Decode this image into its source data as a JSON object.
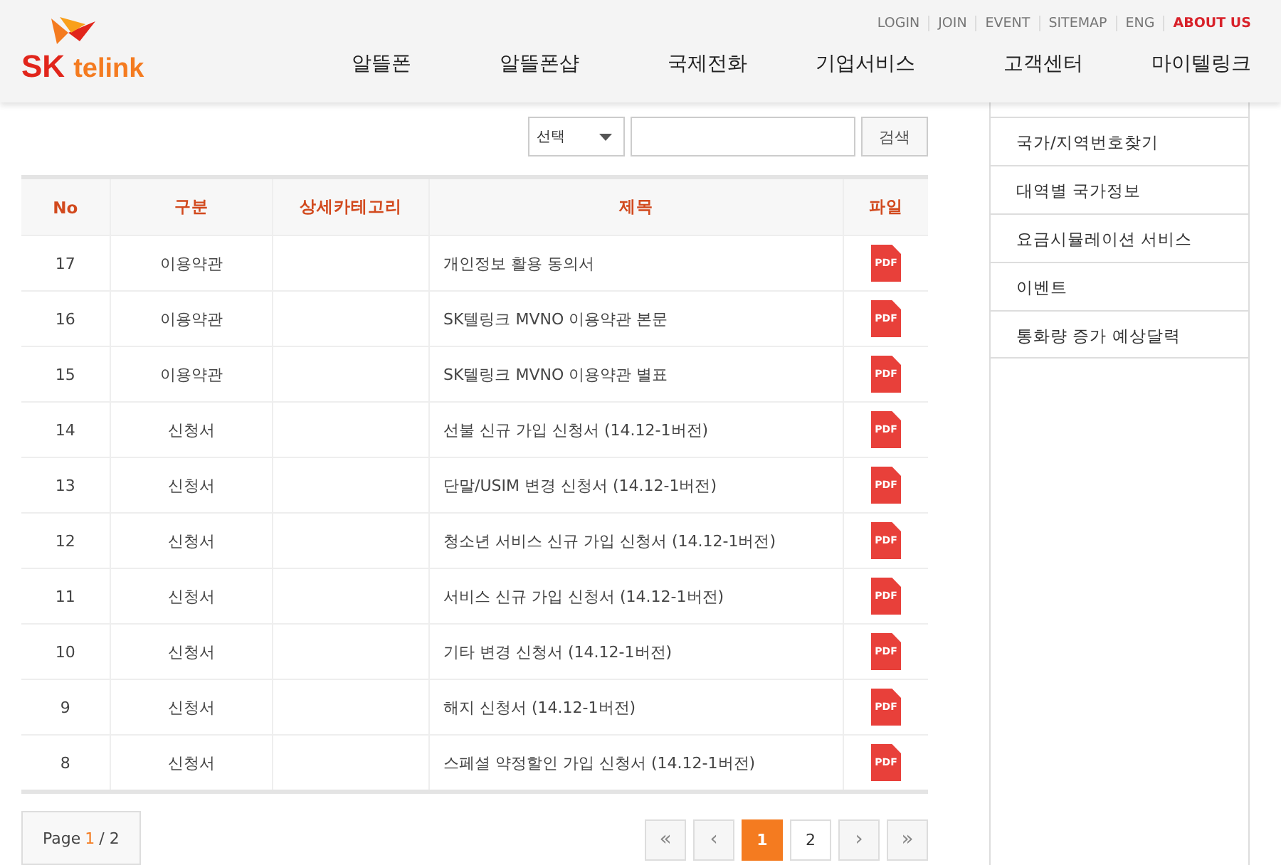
{
  "header": {
    "logo": {
      "mark": "SK",
      "name": "telink"
    },
    "top_links": [
      {
        "label": "LOGIN",
        "selected": false
      },
      {
        "label": "JOIN",
        "selected": false
      },
      {
        "label": "EVENT",
        "selected": false
      },
      {
        "label": "SITEMAP",
        "selected": false
      },
      {
        "label": "ENG",
        "selected": false
      },
      {
        "label": "ABOUT US",
        "selected": true
      }
    ],
    "nav": [
      "알뜰폰",
      "알뜰폰샵",
      "국제전화",
      "기업서비스",
      "고객센터",
      "마이텔링크"
    ]
  },
  "search": {
    "select": "선택",
    "button": "검색"
  },
  "table": {
    "columns": [
      "No",
      "구분",
      "상세카테고리",
      "제목",
      "파일"
    ],
    "rows": [
      {
        "no": "17",
        "type": "이용약관",
        "title": "개인정보 활용 동의서",
        "file": "PDF"
      },
      {
        "no": "16",
        "type": "이용약관",
        "title": "SK텔링크 MVNO 이용약관 본문",
        "file": "PDF"
      },
      {
        "no": "15",
        "type": "이용약관",
        "title": "SK텔링크 MVNO 이용약관 별표",
        "file": "PDF"
      },
      {
        "no": "14",
        "type": "신청서",
        "title": "선불 신규 가입 신청서 (14.12-1버전)",
        "file": "PDF"
      },
      {
        "no": "13",
        "type": "신청서",
        "title": "단말/USIM 변경 신청서 (14.12-1버전)",
        "file": "PDF"
      },
      {
        "no": "12",
        "type": "신청서",
        "title": "청소년 서비스 신규 가입 신청서 (14.12-1버전)",
        "file": "PDF"
      },
      {
        "no": "11",
        "type": "신청서",
        "title": "서비스 신규 가입 신청서 (14.12-1버전)",
        "file": "PDF"
      },
      {
        "no": "10",
        "type": "신청서",
        "title": "기타 변경 신청서 (14.12-1버전)",
        "file": "PDF"
      },
      {
        "no": "9",
        "type": "신청서",
        "title": "해지 신청서 (14.12-1버전)",
        "file": "PDF"
      },
      {
        "no": "8",
        "type": "신청서",
        "title": "스페셜 약정할인 가입 신청서 (14.12-1버전)",
        "file": "PDF"
      }
    ]
  },
  "page_info": {
    "label": "Page",
    "current": "1",
    "total": "/ 2"
  },
  "pagination": [
    {
      "label": "«",
      "kind": "nav",
      "selected": false
    },
    {
      "label": "‹",
      "kind": "nav",
      "selected": false
    },
    {
      "label": "1",
      "kind": "page",
      "selected": true
    },
    {
      "label": "2",
      "kind": "page",
      "selected": false
    },
    {
      "label": "›",
      "kind": "nav",
      "selected": false
    },
    {
      "label": "»",
      "kind": "nav",
      "selected": false
    }
  ],
  "sidebar": {
    "items": [
      "국가/지역번호찾기",
      "대역별 국가정보",
      "요금시뮬레이션 서비스",
      "이벤트",
      "통화량 증가 예상달력"
    ]
  }
}
